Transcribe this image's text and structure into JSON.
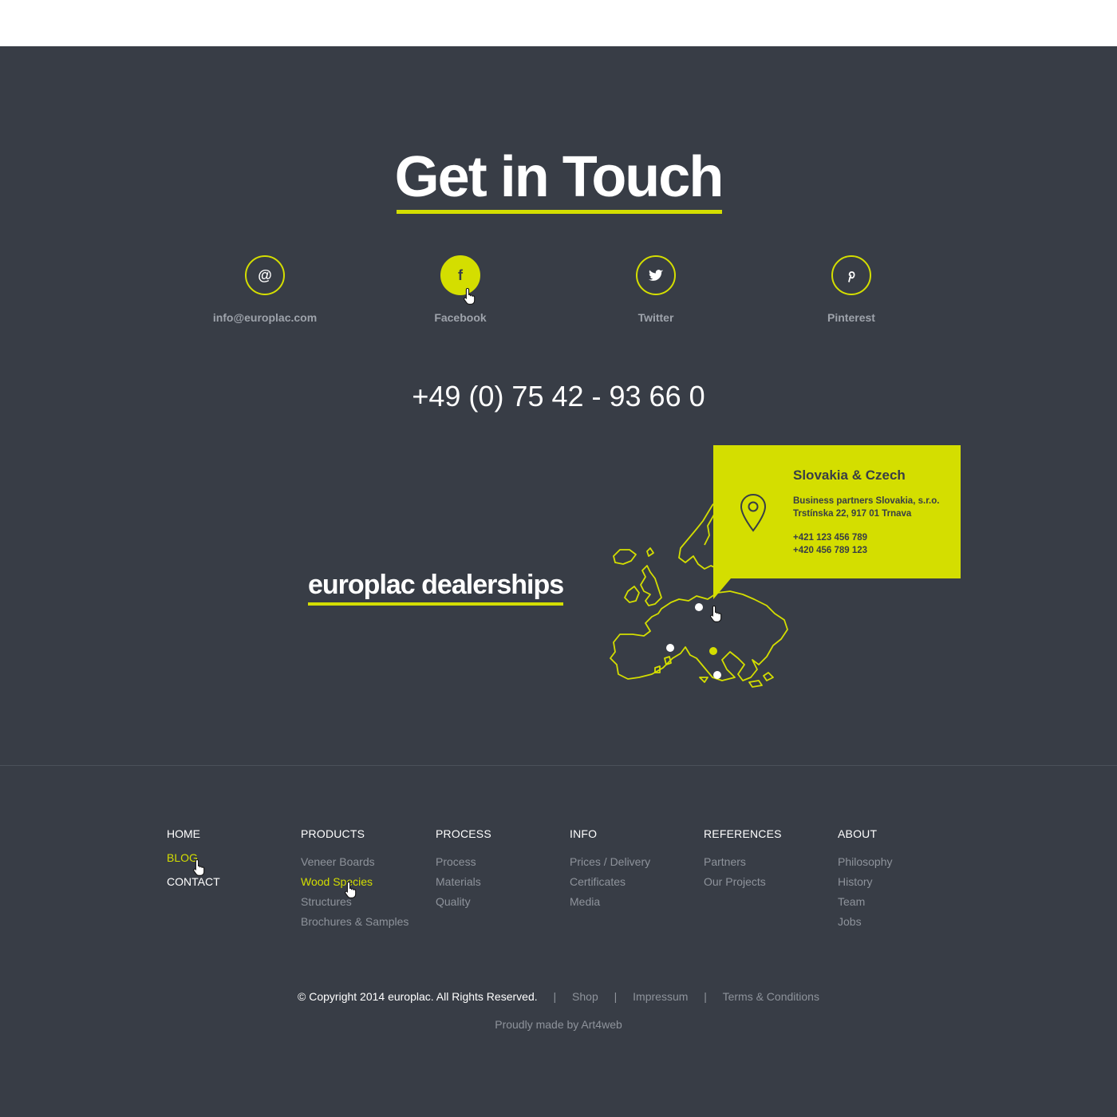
{
  "header": {
    "title": "Get in Touch"
  },
  "contact": {
    "items": [
      {
        "icon": "at-icon",
        "glyph": "@",
        "label": "info@europlac.com"
      },
      {
        "icon": "facebook-icon",
        "glyph": "f",
        "label": "Facebook",
        "active": true
      },
      {
        "icon": "twitter-icon",
        "glyph": "",
        "label": "Twitter"
      },
      {
        "icon": "pinterest-icon",
        "glyph": "",
        "label": "Pinterest"
      }
    ],
    "phone": "+49 (0) 75 42 - 93 66 0"
  },
  "dealerships": {
    "title": "europlac dealerships",
    "popup": {
      "title": "Slovakia & Czech",
      "company": "Business partners Slovakia, s.r.o.",
      "address": "Trstínska 22, 917 01 Trnava",
      "phone1": "+421 123 456 789",
      "phone2": "+420 456 789 123"
    }
  },
  "footer": {
    "home": {
      "items": [
        "HOME",
        "BLOG",
        "CONTACT"
      ],
      "active": "BLOG"
    },
    "columns": [
      {
        "heading": "PRODUCTS",
        "links": [
          "Veneer Boards",
          "Wood Species",
          "Structures",
          "Brochures & Samples"
        ]
      },
      {
        "heading": "PROCESS",
        "links": [
          "Process",
          "Materials",
          "Quality"
        ]
      },
      {
        "heading": "INFO",
        "links": [
          "Prices / Delivery",
          "Certificates",
          "Media"
        ]
      },
      {
        "heading": "REFERENCES",
        "links": [
          "Partners",
          "Our Projects"
        ]
      },
      {
        "heading": "ABOUT",
        "links": [
          "Philosophy",
          "History",
          "Team",
          "Jobs"
        ]
      }
    ],
    "copyright": "© Copyright 2014 europlac. All Rights Reserved.",
    "separator": "|",
    "legal_links": [
      "Shop",
      "Impressum",
      "Terms & Conditions"
    ],
    "made_by": "Proudly made by Art4web"
  },
  "colors": {
    "accent": "#d4de00",
    "background": "#383d46",
    "muted": "#8e939b"
  }
}
